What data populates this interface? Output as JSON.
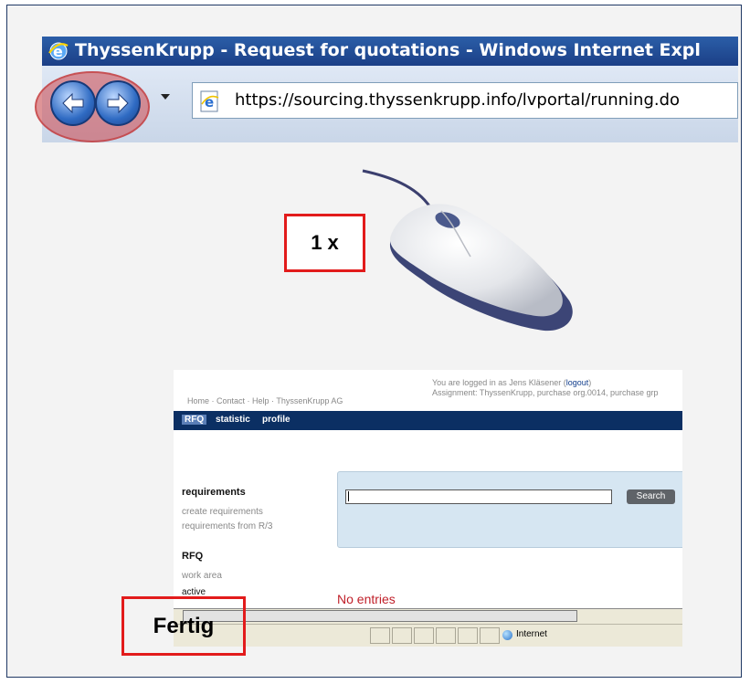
{
  "browser": {
    "window_title": "ThyssenKrupp - Request for quotations - Windows Internet Expl",
    "address_url": "https://sourcing.thyssenkrupp.info/lvportal/running.do",
    "icons": {
      "app": "ie-logo-icon",
      "back": "back-arrow-icon",
      "forward": "forward-arrow-icon",
      "page": "ie-page-icon"
    }
  },
  "callouts": {
    "click_count": "1 x",
    "status_label": "Fertig"
  },
  "portal": {
    "top_nav": "Home · Contact · Help · ThyssenKrupp AG",
    "login_line1_prefix": "You are logged in as Jens Kläsener (",
    "login_link": "logout",
    "login_line1_suffix": ")",
    "login_line2": "Assignment: ThyssenKrupp, purchase org.0014, purchase grp",
    "tabs": [
      "RFQ",
      "statistic",
      "profile"
    ],
    "sidebar": {
      "requirements_heading": "requirements",
      "create_requirements": "create requirements",
      "requirements_from_r3": "requirements from R/3",
      "rfq_heading": "RFQ",
      "work_area": "work area",
      "active": "active"
    },
    "search_button": "Search",
    "no_entries": "No entries",
    "status_zone": "Internet"
  },
  "colors": {
    "callout_border": "#e21b1b",
    "portal_navbar": "#0b2f63",
    "no_entries": "#c0202a",
    "search_panel": "#d6e6f2"
  }
}
